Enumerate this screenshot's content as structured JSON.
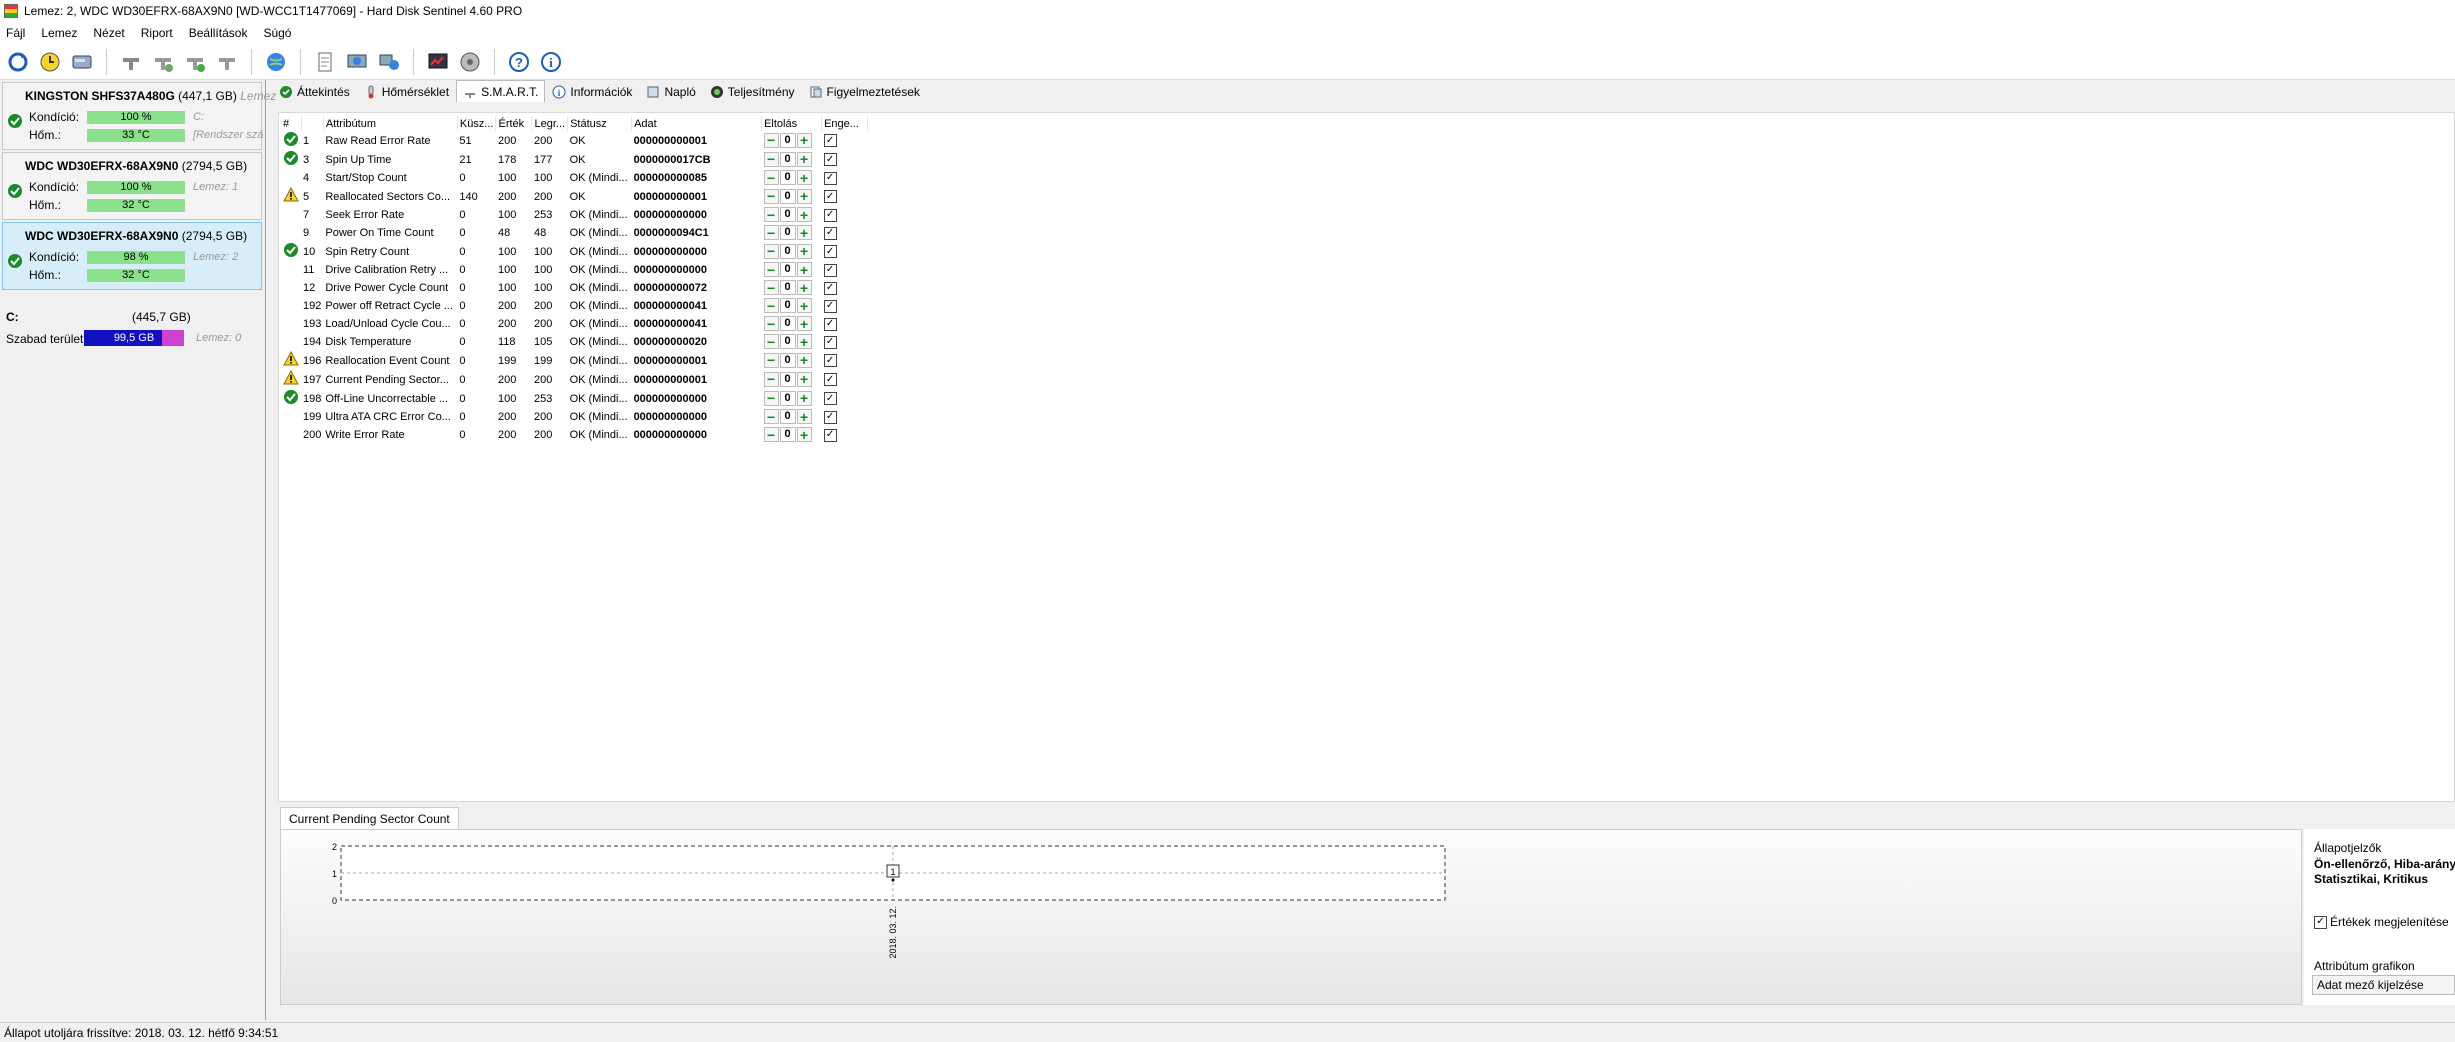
{
  "window": {
    "title": "Lemez: 2, WDC WD30EFRX-68AX9N0 [WD-WCC1T1477069]  -  Hard Disk Sentinel 4.60 PRO"
  },
  "menu": [
    "Fájl",
    "Lemez",
    "Nézet",
    "Riport",
    "Beállítások",
    "Súgó"
  ],
  "toolbar_icons": [
    "refresh-icon",
    "alert-clock-icon",
    "disk-icon",
    "tool-icon",
    "tool2-icon",
    "tool3-icon",
    "tool4-icon",
    "globe-icon",
    "report-icon",
    "network-icon",
    "network2-icon",
    "chart-icon",
    "disk-spin-icon",
    "help-icon",
    "info-icon"
  ],
  "disks": [
    {
      "name": "KINGSTON SHFS37A480G",
      "size": "(447,1 GB)",
      "extra": "Lemez",
      "kondicio_label": "Kondíció:",
      "kondicio": "100 %",
      "kondicio_pct": 100,
      "hom_label": "Hőm.:",
      "hom": "33 °C",
      "side1": "C:",
      "side2": "[Rendszer szá"
    },
    {
      "name": "WDC WD30EFRX-68AX9N0",
      "size": "(2794,5 GB)",
      "extra": "",
      "kondicio_label": "Kondíció:",
      "kondicio": "100 %",
      "kondicio_pct": 100,
      "hom_label": "Hőm.:",
      "hom": "32 °C",
      "side1": "Lemez: 1",
      "side2": ""
    },
    {
      "name": "WDC WD30EFRX-68AX9N0",
      "size": "(2794,5 GB)",
      "extra": "",
      "kondicio_label": "Kondíció:",
      "kondicio": "98 %",
      "kondicio_pct": 98,
      "hom_label": "Hőm.:",
      "hom": "32 °C",
      "side1": "Lemez: 2",
      "side2": ""
    }
  ],
  "volume": {
    "name": "C:",
    "size": "(445,7 GB)",
    "free_label": "Szabad terület",
    "free": "99,5 GB",
    "disk": "Lemez: 0"
  },
  "tabs": [
    "Áttekintés",
    "Hőmérséklet",
    "S.M.A.R.T.",
    "Információk",
    "Napló",
    "Teljesítmény",
    "Figyelmeztetések"
  ],
  "smart": {
    "headers": [
      "#",
      "Attribútum",
      "Küsz...",
      "Érték",
      "Legr...",
      "Státusz",
      "Adat",
      "Eltolás",
      "Enge..."
    ],
    "rows": [
      {
        "icon": "ok",
        "num": "1",
        "attr": "Raw Read Error Rate",
        "th": "51",
        "val": "200",
        "worst": "200",
        "stat": "OK",
        "data": "000000000001",
        "off": "0"
      },
      {
        "icon": "ok",
        "num": "3",
        "attr": "Spin Up Time",
        "th": "21",
        "val": "178",
        "worst": "177",
        "stat": "OK",
        "data": "0000000017CB",
        "off": "0"
      },
      {
        "icon": "",
        "num": "4",
        "attr": "Start/Stop Count",
        "th": "0",
        "val": "100",
        "worst": "100",
        "stat": "OK (Mindi...",
        "data": "000000000085",
        "off": "0"
      },
      {
        "icon": "warn",
        "num": "5",
        "attr": "Reallocated Sectors Co...",
        "th": "140",
        "val": "200",
        "worst": "200",
        "stat": "OK",
        "data": "000000000001",
        "off": "0"
      },
      {
        "icon": "",
        "num": "7",
        "attr": "Seek Error Rate",
        "th": "0",
        "val": "100",
        "worst": "253",
        "stat": "OK (Mindi...",
        "data": "000000000000",
        "off": "0"
      },
      {
        "icon": "",
        "num": "9",
        "attr": "Power On Time Count",
        "th": "0",
        "val": "48",
        "worst": "48",
        "stat": "OK (Mindi...",
        "data": "0000000094C1",
        "off": "0"
      },
      {
        "icon": "ok",
        "num": "10",
        "attr": "Spin Retry Count",
        "th": "0",
        "val": "100",
        "worst": "100",
        "stat": "OK (Mindi...",
        "data": "000000000000",
        "off": "0"
      },
      {
        "icon": "",
        "num": "11",
        "attr": "Drive Calibration Retry ...",
        "th": "0",
        "val": "100",
        "worst": "100",
        "stat": "OK (Mindi...",
        "data": "000000000000",
        "off": "0"
      },
      {
        "icon": "",
        "num": "12",
        "attr": "Drive Power Cycle Count",
        "th": "0",
        "val": "100",
        "worst": "100",
        "stat": "OK (Mindi...",
        "data": "000000000072",
        "off": "0"
      },
      {
        "icon": "",
        "num": "192",
        "attr": "Power off Retract Cycle ...",
        "th": "0",
        "val": "200",
        "worst": "200",
        "stat": "OK (Mindi...",
        "data": "000000000041",
        "off": "0"
      },
      {
        "icon": "",
        "num": "193",
        "attr": "Load/Unload Cycle Cou...",
        "th": "0",
        "val": "200",
        "worst": "200",
        "stat": "OK (Mindi...",
        "data": "000000000041",
        "off": "0"
      },
      {
        "icon": "",
        "num": "194",
        "attr": "Disk Temperature",
        "th": "0",
        "val": "118",
        "worst": "105",
        "stat": "OK (Mindi...",
        "data": "000000000020",
        "off": "0"
      },
      {
        "icon": "warn",
        "num": "196",
        "attr": "Reallocation Event Count",
        "th": "0",
        "val": "199",
        "worst": "199",
        "stat": "OK (Mindi...",
        "data": "000000000001",
        "off": "0"
      },
      {
        "icon": "warn",
        "num": "197",
        "attr": "Current Pending Sector...",
        "th": "0",
        "val": "200",
        "worst": "200",
        "stat": "OK (Mindi...",
        "data": "000000000001",
        "off": "0"
      },
      {
        "icon": "ok",
        "num": "198",
        "attr": "Off-Line Uncorrectable ...",
        "th": "0",
        "val": "100",
        "worst": "253",
        "stat": "OK (Mindi...",
        "data": "000000000000",
        "off": "0"
      },
      {
        "icon": "",
        "num": "199",
        "attr": "Ultra ATA CRC Error Co...",
        "th": "0",
        "val": "200",
        "worst": "200",
        "stat": "OK (Mindi...",
        "data": "000000000000",
        "off": "0"
      },
      {
        "icon": "",
        "num": "200",
        "attr": "Write Error Rate",
        "th": "0",
        "val": "200",
        "worst": "200",
        "stat": "OK (Mindi...",
        "data": "000000000000",
        "off": "0"
      }
    ]
  },
  "graph": {
    "tab": "Current Pending Sector Count",
    "chart_data": {
      "type": "line",
      "x": [
        "2018. 03. 12."
      ],
      "series": [
        {
          "values": [
            1
          ]
        }
      ],
      "point_labels": [
        "1"
      ],
      "yticks": [
        "2",
        "1",
        "0"
      ],
      "ylim": [
        0,
        2
      ],
      "grid": true
    }
  },
  "right_panel": {
    "title": "Állapotjelzők",
    "bold_line1": "Ön-ellenőrző, Hiba-arány,",
    "bold_line2": "Statisztikai, Kritikus",
    "show_values": "Értékek megjelenítése",
    "attr_graph_label": "Attribútum grafikon",
    "attr_graph_value": "Adat mező kijelzése"
  },
  "statusbar": "Állapot utoljára frissítve: 2018. 03. 12. hétfő 9:34:51",
  "colors": {
    "ok_green": "#1a8a2a",
    "bar_green": "#8be08b",
    "selected": "#d7eefa",
    "free_blue": "#1010c0",
    "free_magenta": "#d040d0"
  }
}
